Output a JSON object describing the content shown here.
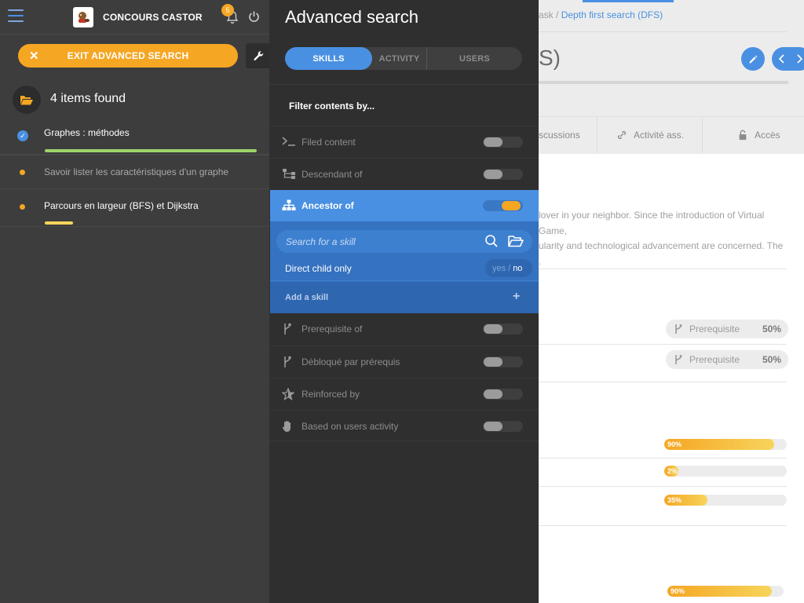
{
  "main": {
    "breadcrumb": {
      "prefix": "ask",
      "separator": "/",
      "current": "Depth first search (DFS)"
    },
    "title_fragment": "S)",
    "tabs": [
      {
        "label": "scussions"
      },
      {
        "label": "Activité ass."
      },
      {
        "label": "Accès"
      }
    ],
    "paragraph": [
      "lover in your neighbor. Since the introduction of Virtual Game,",
      "ularity and technological advancement are concerned. The",
      "."
    ],
    "prerequisites": [
      {
        "label": "Prerequisite",
        "percent": "50%"
      },
      {
        "label": "Prerequisite",
        "percent": "50%"
      }
    ],
    "progress_bars": [
      {
        "label": "90%",
        "value": 0.9
      },
      {
        "label": "2%",
        "value": 0.02
      },
      {
        "label": "35%",
        "value": 0.35
      },
      {
        "label": "90%",
        "value": 0.9
      }
    ]
  },
  "sidebar": {
    "brand": "CONCOURS CASTOR",
    "notifications_count": "5",
    "exit_label": "EXIT ADVANCED SEARCH",
    "found_label": "4 items found",
    "items": [
      {
        "label": "Graphes : méthodes",
        "status": "validated",
        "progress": 1.0,
        "progress_color": "#9ed36a"
      },
      {
        "label": "Savoir lister les caractéristiques d'un graphe",
        "status": "in-progress"
      },
      {
        "label": "Parcours en largeur (BFS) et Dijkstra",
        "status": "in-progress",
        "progress": 0.13,
        "progress_color": "#f7d45c"
      }
    ]
  },
  "panel": {
    "title": "Advanced search",
    "tabs": [
      {
        "label": "SKILLS",
        "active": true
      },
      {
        "label": "ACTIVITY",
        "active": false
      },
      {
        "label": "USERS",
        "active": false
      }
    ],
    "filter_title": "Filter contents by...",
    "filters": [
      {
        "label": "Filed content",
        "icon": "terminal-icon",
        "enabled": false
      },
      {
        "label": "Descendant of",
        "icon": "tree-descendant-icon",
        "enabled": false
      },
      {
        "label": "Ancestor of",
        "icon": "sitemap-icon",
        "enabled": true
      },
      {
        "label": "Prerequisite of",
        "icon": "branch-icon",
        "enabled": false
      },
      {
        "label": "Débloqué par prérequis",
        "icon": "branch-icon",
        "enabled": false
      },
      {
        "label": "Reinforced by",
        "icon": "star-icon",
        "enabled": false
      },
      {
        "label": "Based on users activity",
        "icon": "hand-icon",
        "enabled": false
      }
    ],
    "ancestor": {
      "search_placeholder": "Search for a skill",
      "direct_child_label": "Direct child only",
      "yes_label": "yes",
      "no_label": "no",
      "yes_no_separator": "/",
      "add_skill_label": "Add a skill"
    }
  },
  "colors": {
    "accent": "#4a90e2",
    "warning": "#f5a623",
    "sidebar_bg": "#3d3d3d",
    "panel_bg": "#2f2f2f"
  }
}
